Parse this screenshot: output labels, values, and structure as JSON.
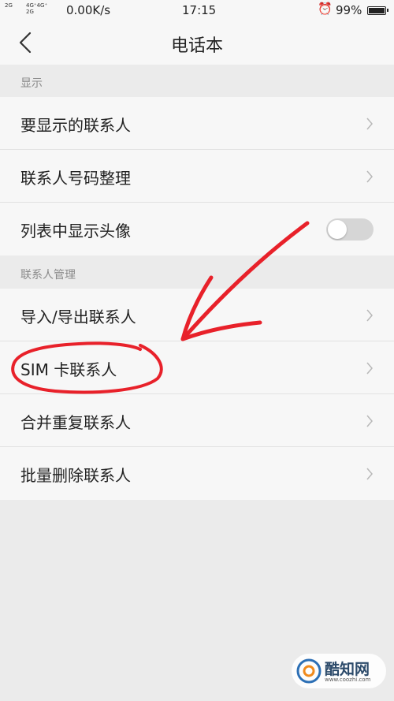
{
  "status_bar": {
    "signal1": "2G",
    "signal2_top": "4G⁺4G⁺",
    "signal2_bottom": "2G",
    "net_speed": "0.00K/s",
    "time": "17:15",
    "alarm_icon": "alarm-icon",
    "battery": "99%"
  },
  "nav": {
    "title": "电话本",
    "back_icon": "chevron-left-icon"
  },
  "sections": [
    {
      "header": "显示",
      "items": [
        {
          "label": "要显示的联系人",
          "control": "chevron"
        },
        {
          "label": "联系人号码整理",
          "control": "chevron"
        },
        {
          "label": "列表中显示头像",
          "control": "toggle",
          "on": false
        }
      ]
    },
    {
      "header": "联系人管理",
      "items": [
        {
          "label": "导入/导出联系人",
          "control": "chevron"
        },
        {
          "label": "SIM 卡联系人",
          "control": "chevron"
        },
        {
          "label": "合并重复联系人",
          "control": "chevron"
        },
        {
          "label": "批量删除联系人",
          "control": "chevron"
        }
      ]
    }
  ],
  "annotation": {
    "color": "#e8212a",
    "circled_item": "SIM 卡联系人"
  },
  "watermark": {
    "text": "酷知网",
    "url": "www.coozhi.com"
  }
}
